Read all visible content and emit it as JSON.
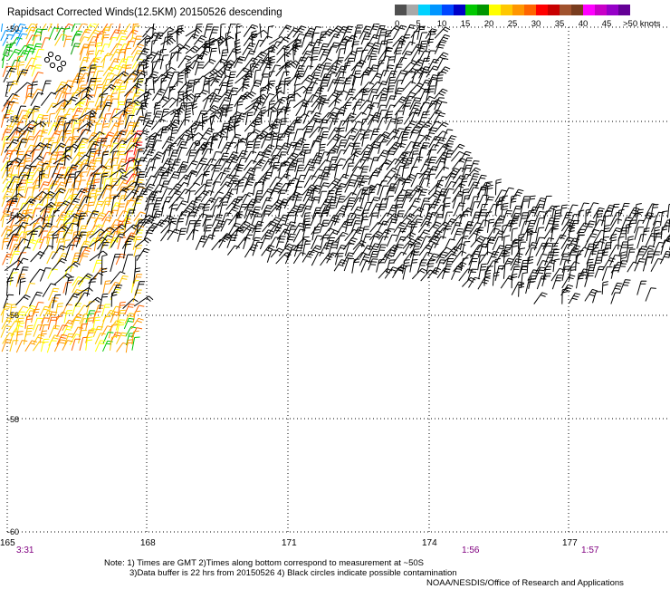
{
  "title": "Rapidsact Corrected Winds(12.5KM) 20150526 descending",
  "legend": {
    "labels": [
      "0",
      "5",
      "10",
      "15",
      "20",
      "25",
      "30",
      "35",
      "40",
      "45",
      ">50 knots"
    ],
    "colors": [
      "#505050",
      "#a8a8a8",
      "#00d2ff",
      "#0096ff",
      "#0046ff",
      "#0000c8",
      "#00c800",
      "#009600",
      "#ffff00",
      "#ffc800",
      "#ff9600",
      "#ff6400",
      "#ff0000",
      "#c80000",
      "#a0522d",
      "#783c1e",
      "#ff00ff",
      "#c800c8",
      "#9600c8",
      "#640096"
    ]
  },
  "grid": {
    "latitudes": [
      "-50",
      "-52",
      "-54",
      "-56",
      "-58",
      "-60"
    ],
    "longitudes": [
      "165",
      "168",
      "171",
      "174",
      "177"
    ]
  },
  "pass_times": [
    "3:31",
    "1:56",
    "1:57"
  ],
  "notes": [
    "Note: 1) Times are GMT 2)Times along bottom correspond to measurement at ~50S",
    "3)Data buffer is 22 hrs from 20150526 4) Black circles indicate possible contamination"
  ],
  "credit": "NOAA/NESDIS/Office of Research and Applications",
  "colors": {
    "barb": "#000000",
    "time_label": "#800080",
    "grid": "#000000"
  }
}
